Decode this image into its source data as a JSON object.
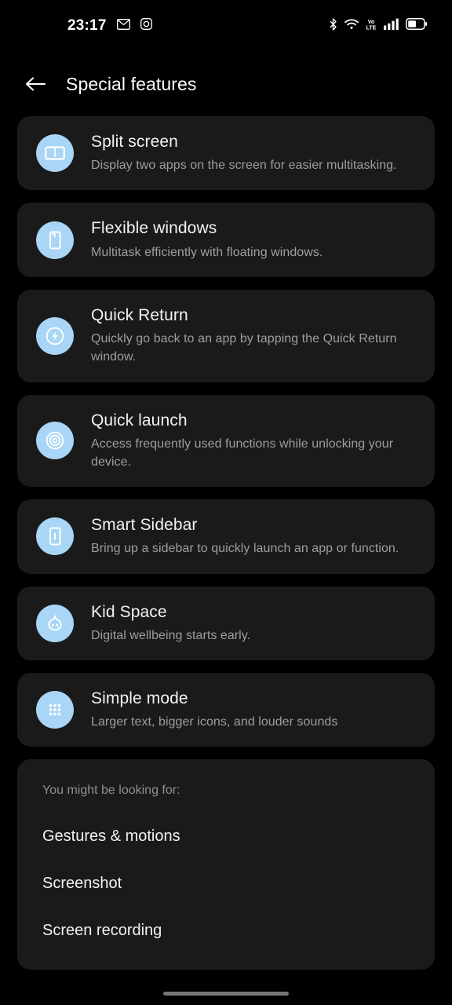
{
  "status_bar": {
    "time": "23:17",
    "left_icons": [
      "gmail-icon",
      "instagram-icon"
    ],
    "right_icons": [
      "bluetooth-icon",
      "wifi-icon",
      "volte-icon",
      "signal-icon",
      "battery-icon"
    ],
    "volte_label_top": "Vo",
    "volte_label_bottom": "LTE"
  },
  "header": {
    "back_icon": "arrow-left-icon",
    "title": "Special features"
  },
  "colors": {
    "background": "#000000",
    "card": "#1a1a1a",
    "icon_circle": "#a9d5f6",
    "title_text": "#f2f2f2",
    "desc_text": "#9e9e9e",
    "muted_text": "#8f8f8f"
  },
  "features": [
    {
      "icon": "split-screen-icon",
      "title": "Split screen",
      "desc": "Display two apps on the screen for easier multitasking."
    },
    {
      "icon": "flexible-window-icon",
      "title": "Flexible windows",
      "desc": "Multitask efficiently with floating windows."
    },
    {
      "icon": "quick-return-icon",
      "title": "Quick Return",
      "desc": "Quickly go back to an app by tapping the Quick Return window."
    },
    {
      "icon": "quick-launch-icon",
      "title": "Quick launch",
      "desc": "Access frequently used functions while unlocking your device."
    },
    {
      "icon": "smart-sidebar-icon",
      "title": "Smart Sidebar",
      "desc": "Bring up a sidebar to quickly launch an app or function."
    },
    {
      "icon": "kid-space-icon",
      "title": "Kid Space",
      "desc": "Digital wellbeing starts early."
    },
    {
      "icon": "simple-mode-icon",
      "title": "Simple mode",
      "desc": "Larger text, bigger icons, and louder sounds"
    }
  ],
  "suggestions": {
    "heading": "You might be looking for:",
    "links": [
      "Gestures & motions",
      "Screenshot",
      "Screen recording"
    ]
  }
}
